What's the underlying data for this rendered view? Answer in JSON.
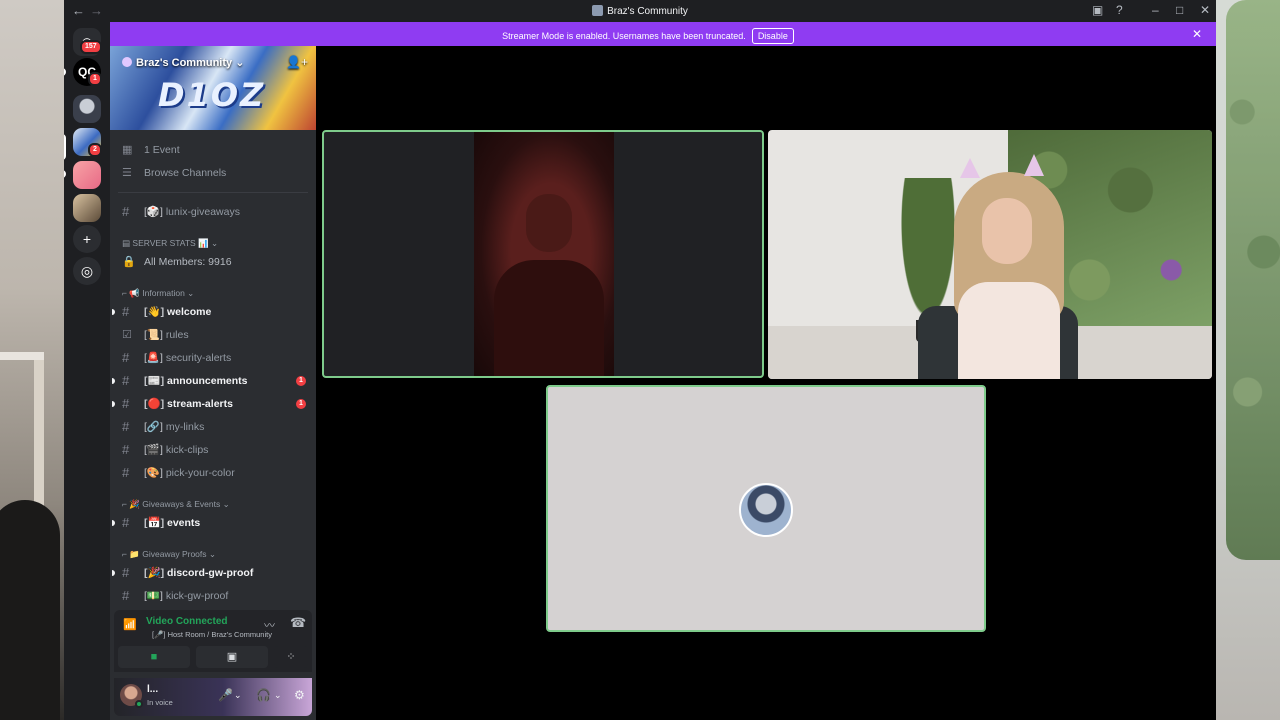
{
  "window": {
    "title": "Braz's Community"
  },
  "rail": {
    "home_badge": "157",
    "server2_label": "QC",
    "server2_badge": "1",
    "server4_badge": "2",
    "add_server_icon": "+",
    "discover_icon": "compass"
  },
  "banner": {
    "message": "Streamer Mode is enabled. Usernames have been truncated.",
    "button": "Disable"
  },
  "server": {
    "name": "Braz's Community",
    "banner_text": "D1OZ"
  },
  "sidebar": {
    "events": "1 Event",
    "browse": "Browse Channels",
    "channel_giveaways": {
      "emoji": "[🎲]",
      "name": "lunix-giveaways"
    },
    "cat_server_stats": "SERVER STATS 📊",
    "all_members": "All Members: 9916",
    "cat_information": "📢 Information",
    "channels_info": [
      {
        "emoji": "[👋]",
        "name": "welcome"
      },
      {
        "emoji": "[📜]",
        "name": "rules"
      },
      {
        "emoji": "[🚨]",
        "name": "security-alerts"
      },
      {
        "emoji": "[📰]",
        "name": "announcements",
        "count": "1"
      },
      {
        "emoji": "[🔴]",
        "name": "stream-alerts",
        "count": "1"
      },
      {
        "emoji": "[🔗]",
        "name": "my-links"
      },
      {
        "emoji": "[🎬]",
        "name": "kick-clips"
      },
      {
        "emoji": "[🎨]",
        "name": "pick-your-color"
      }
    ],
    "cat_giveaways": "🎉 Giveaways & Events",
    "channel_events": {
      "emoji": "[📅]",
      "name": "events"
    },
    "cat_proofs": "📁 Giveaway Proofs",
    "channel_discord_proof": {
      "emoji": "[🎉]",
      "name": "discord-gw-proof"
    },
    "channel_kick_proof": {
      "emoji": "[💵]",
      "name": "kick-gw-proof"
    }
  },
  "voice": {
    "status": "Video Connected",
    "room": "[🎤] Host Room / Braz's Community"
  },
  "user": {
    "name": "l...",
    "status": "In voice"
  },
  "colors": {
    "accent": "#8f3cf2",
    "connected": "#23a55a",
    "speaking_border": "#7ecb8b",
    "badge": "#f23f43"
  }
}
